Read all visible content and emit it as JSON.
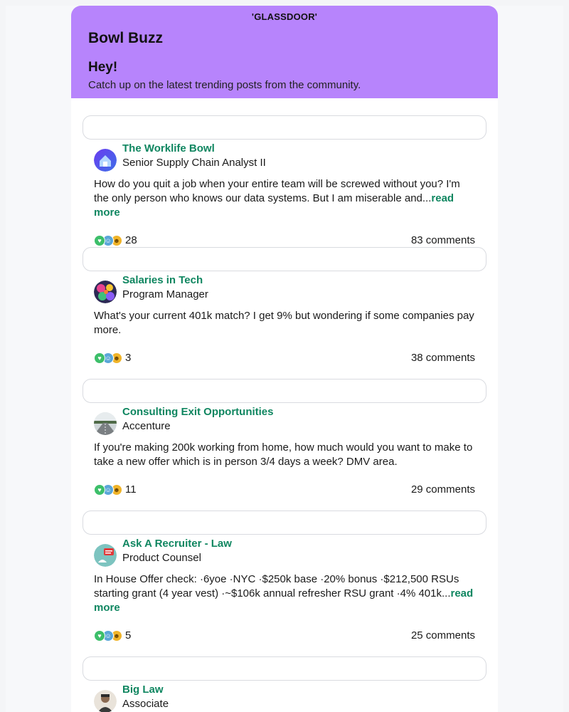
{
  "brand": {
    "logo_text": "'GLASSDOOR'",
    "header_bg": "#b784fc",
    "accent": "#0f8660"
  },
  "header": {
    "title": "Bowl Buzz",
    "greeting": "Hey!",
    "subtitle": "Catch up on the latest trending posts from the community."
  },
  "posts": [
    {
      "bowl": "The Worklife Bowl",
      "job_title": "Senior Supply Chain Analyst II",
      "text": "How do you quit a job when your entire team will be screwed without you? I'm the only person who knows our data systems. But I am miserable and...",
      "read_more": "read more",
      "reactions": "28",
      "comments": "83 comments",
      "avatar_icon": "house-logo-icon"
    },
    {
      "bowl": "Salaries in Tech",
      "job_title": "Program Manager",
      "text": "What's your current 401k match? I get 9% but wondering if some companies pay more.",
      "read_more": "",
      "reactions": "3",
      "comments": "38 comments",
      "avatar_icon": "colorful-pattern-icon"
    },
    {
      "bowl": "Consulting Exit Opportunities",
      "job_title": "Accenture",
      "text": "If you're making 200k working from home, how much would you want to make to take a new offer which is in person 3/4 days a week? DMV area.",
      "read_more": "",
      "reactions": "11",
      "comments": "29 comments",
      "avatar_icon": "road-photo-icon"
    },
    {
      "bowl": "Ask A Recruiter - Law",
      "job_title": "Product Counsel",
      "text": "In House Offer check: ·6yoe ·NYC ·$250k base ·20% bonus ·$212,500 RSUs starting grant (4 year vest) ·~$106k annual refresher RSU grant ·4% 401k...",
      "read_more": "read more",
      "reactions": "5",
      "comments": "25 comments",
      "avatar_icon": "new-badge-icon"
    },
    {
      "bowl": "Big Law",
      "job_title": "Associate",
      "text": "",
      "read_more": "",
      "reactions": "",
      "comments": "",
      "avatar_icon": "portrait-photo-icon"
    }
  ]
}
